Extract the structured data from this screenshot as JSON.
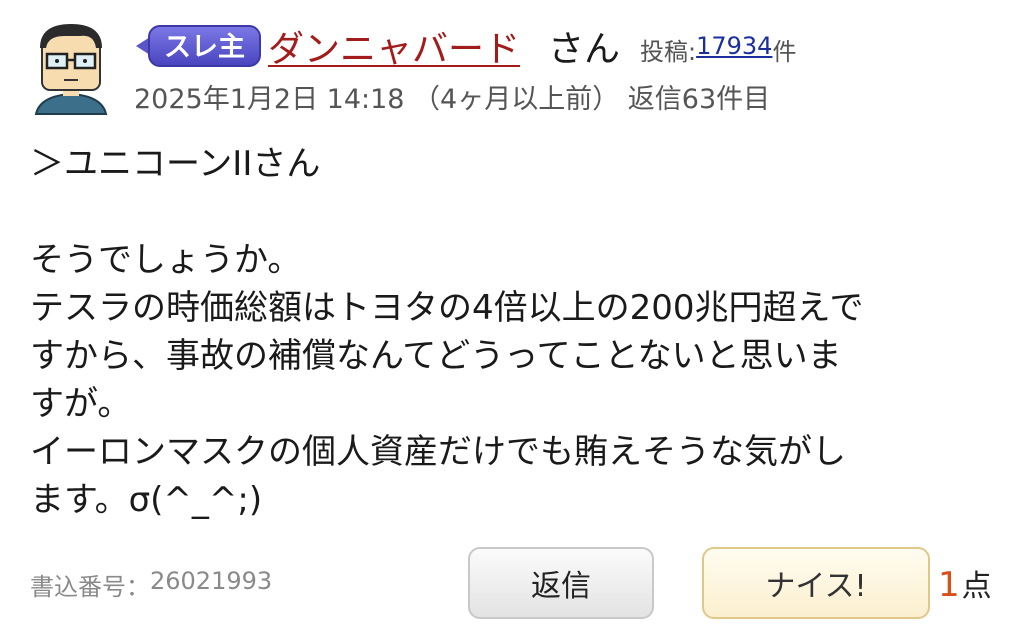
{
  "post": {
    "avatar_icon": "glasses-man-avatar-icon",
    "badge_label": "スレ主",
    "username": "ダンニャバード",
    "honorific": "さん",
    "posts_label": "投稿:",
    "posts_count": "17934",
    "posts_unit": "件",
    "meta": "2025年1月2日 14:18 （4ヶ月以上前） 返信63件目",
    "body_lines": [
      "＞ユニコーンIIさん",
      "",
      "そうでしょうか。",
      "テスラの時価総額はトヨタの4倍以上の200兆円超えで",
      "すから、事故の補償なんてどうってことないと思いま",
      "すが。",
      "イーロンマスクの個人資産だけでも賄えそうな気がし",
      "ます。σ(^_^;)"
    ],
    "post_number_label": "書込番号：",
    "post_number": "26021993"
  },
  "actions": {
    "reply_label": "返信",
    "nice_label": "ナイス!",
    "score": "1",
    "score_unit": "点"
  },
  "colors": {
    "username": "#a31c1c",
    "badge": "#5a56c9",
    "score": "#d94f1a",
    "link": "#1a2f9c"
  }
}
